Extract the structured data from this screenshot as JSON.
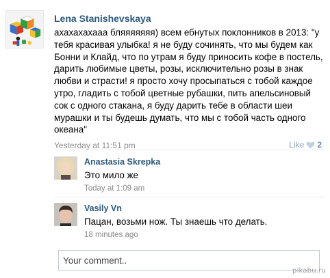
{
  "post": {
    "author": "Lena Stanishevskaya",
    "text": "ахахахахааа бляяяяяяя) всем ебнутых поклонников в 2013: \"у тебя красивая улыбка! я не буду сочинять, что мы будем как Бонни и Клайд, что по утрам я буду приносить кофе в постель, дарить любимые цветы, розы, исключительно розы в знак любви и страсти! я просто хочу просыпаться с тобой каждое утро, гладить с тобой цветные рубашки, пить апельсиновый сок с одного стакана, я буду дарить тебе в области шеи мурашки и ты будешь думать, что мы с тобой часть одного океана\"",
    "timestamp": "Yesterday at 11:51 pm",
    "like_label": "Like",
    "like_count": "2",
    "colors": {
      "author": "#2b587a",
      "like": "#8a9db5",
      "heart": "#c3d0df"
    }
  },
  "comments": [
    {
      "author": "Anastasia Skrepka",
      "text": "Это мило же",
      "timestamp": "Today at 1:09 am"
    },
    {
      "author": "Vasily Vn",
      "text": "Пацан, возьми нож. Ты знаешь что делать.",
      "timestamp": "18 minutes ago"
    }
  ],
  "reply": {
    "placeholder": "Your comment.."
  },
  "watermark": "pikabu.ru"
}
